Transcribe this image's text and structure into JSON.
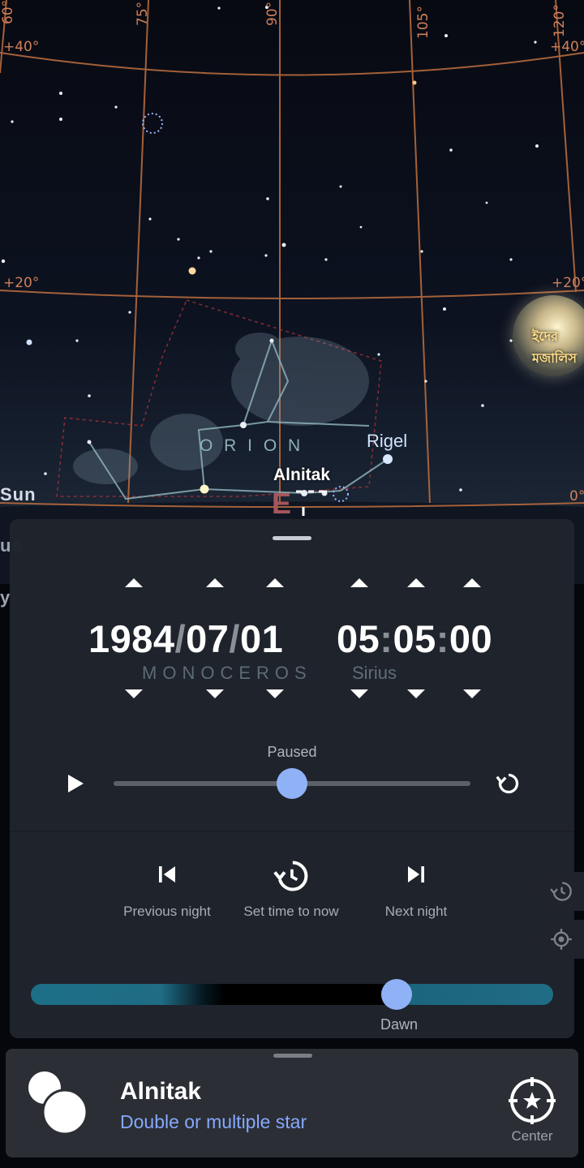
{
  "sky": {
    "grid_labels": {
      "ra_75": "75°",
      "ra_90": "90°",
      "ra_105": "105°",
      "ra_120": "120°",
      "ra_60": "60°",
      "dec_40_left": "+40°",
      "dec_40_right": "+40°",
      "dec_20_left": "+20°",
      "dec_20_right": "+20°",
      "dec_0_right": "0°"
    },
    "constellation": "O R I O N",
    "star_rigel": "Rigel",
    "star_alnitak": "Alnitak",
    "compass_east": "E",
    "side_labels": {
      "sun": "Sun",
      "us": "us",
      "y": "y"
    },
    "moon_widget_text": "ইদের মজালিস"
  },
  "time_panel": {
    "year": "1984",
    "month": "07",
    "day": "01",
    "date_sep": "/",
    "hour": "05",
    "minute": "05",
    "second": "00",
    "time_sep": ":",
    "bg_label_constellation": "MONOCEROS",
    "bg_label_star": "Sirius",
    "status": "Paused",
    "speed_slider_value": 0.5,
    "previous_night": "Previous night",
    "set_time_now": "Set time to now",
    "next_night": "Next night",
    "day_phase_label": "Dawn",
    "day_phase_value": 0.7
  },
  "info_card": {
    "name": "Alnitak",
    "type": "Double or multiple star",
    "center_label": "Center"
  },
  "colors": {
    "accent": "#8fb1f6",
    "object_type": "#86a8ff",
    "grid": "#d0805a",
    "constellation": "#8cb0b8"
  }
}
